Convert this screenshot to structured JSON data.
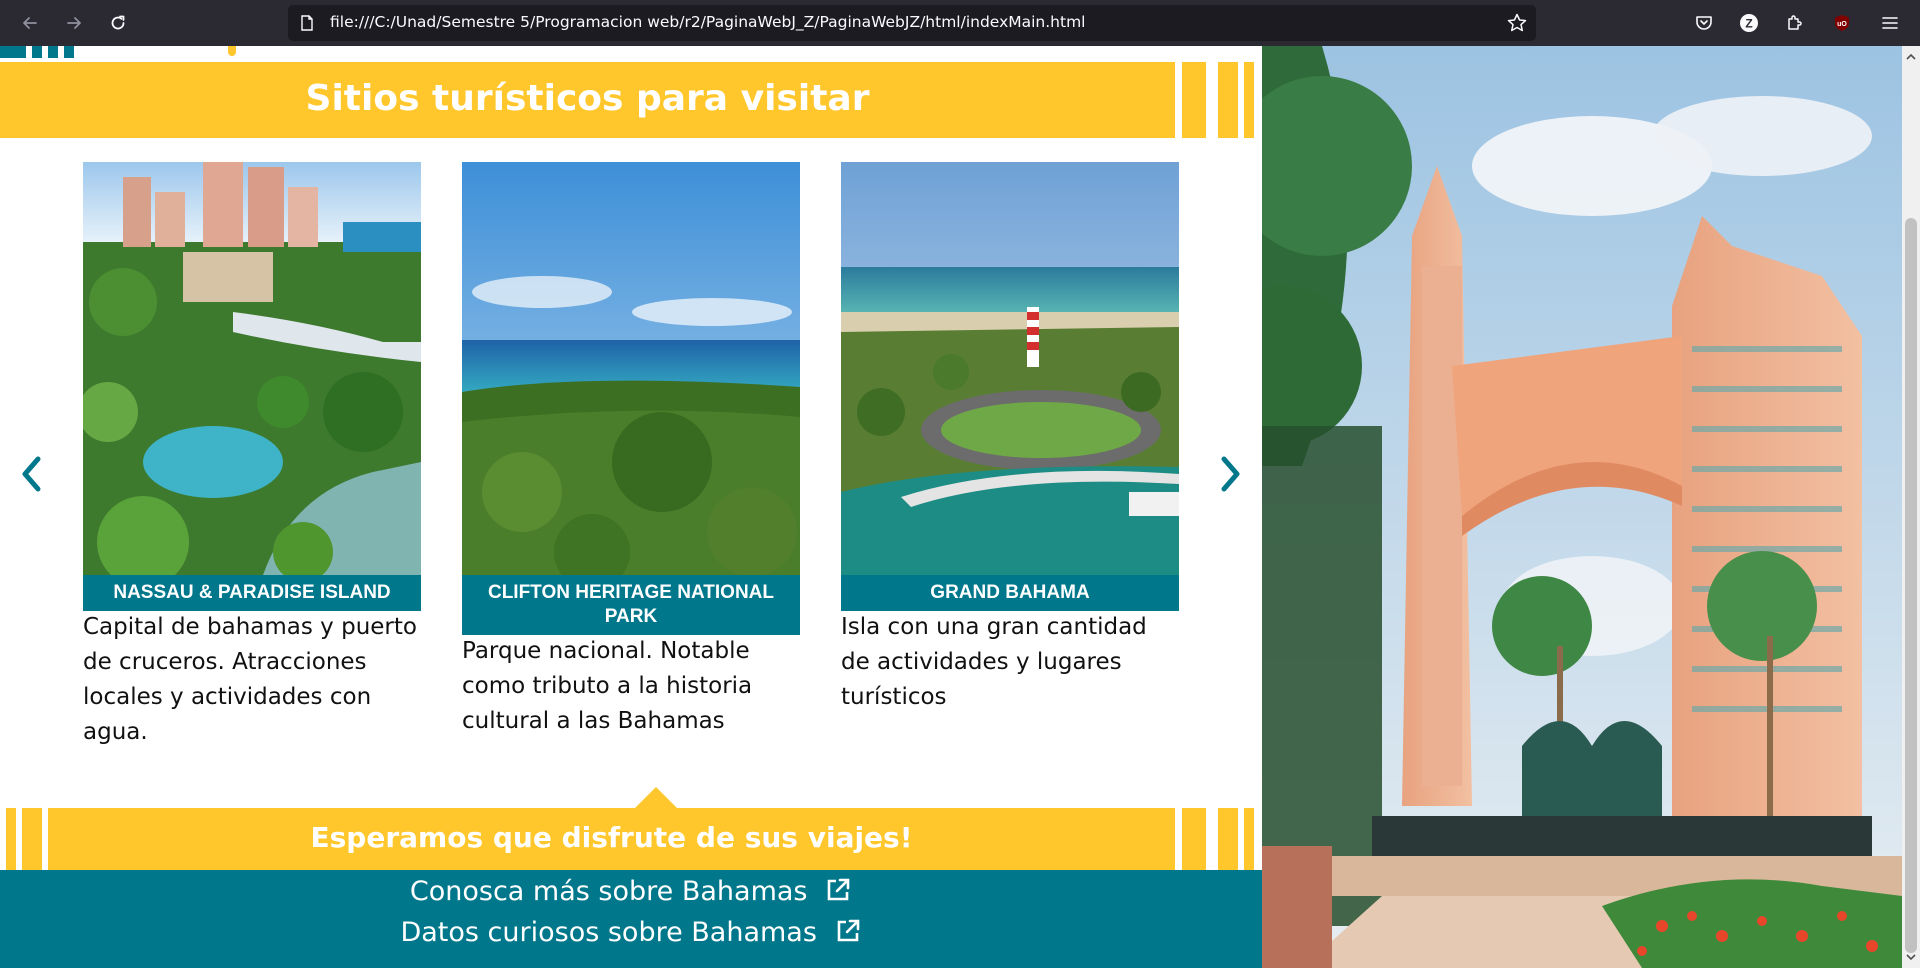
{
  "browser": {
    "url": "file:///C:/Unad/Semestre 5/Programacion web/r2/PaginaWebJ_Z/PaginaWebJZ/html/indexMain.html",
    "back_icon": "back-arrow-icon",
    "forward_icon": "forward-arrow-icon",
    "reload_icon": "reload-icon",
    "toolbar_icons": [
      "pocket-icon",
      "zotero-icon",
      "extensions-icon",
      "ublock-icon",
      "menu-icon"
    ],
    "zotero_letter": "Z",
    "ublock_letter": "uO"
  },
  "section": {
    "title": "Sitios turísticos para visitar"
  },
  "carousel": {
    "prev_icon": "chevron-left-icon",
    "next_icon": "chevron-right-icon",
    "cards": [
      {
        "label": "NASSAU & PARADISE ISLAND",
        "description": "Capital de bahamas y puerto de cruceros. Atracciones locales y actividades con agua."
      },
      {
        "label": "CLIFTON HERITAGE NATIONAL PARK",
        "description": "Parque nacional. Notable como tributo a la historia cultural a las Bahamas"
      },
      {
        "label": "GRAND BAHAMA",
        "description": "Isla con una gran cantidad de actividades y lugares turísticos"
      }
    ]
  },
  "closing": {
    "title": "Esperamos que disfrute de sus viajes!"
  },
  "footer": {
    "links": [
      {
        "label": "Conosca más sobre Bahamas",
        "icon": "external-link-icon"
      },
      {
        "label": "Datos curiosos sobre Bahamas",
        "icon": "external-link-icon"
      }
    ]
  },
  "colors": {
    "yellow": "#ffc72c",
    "teal": "#00778b",
    "chrome": "#2b2a33"
  }
}
